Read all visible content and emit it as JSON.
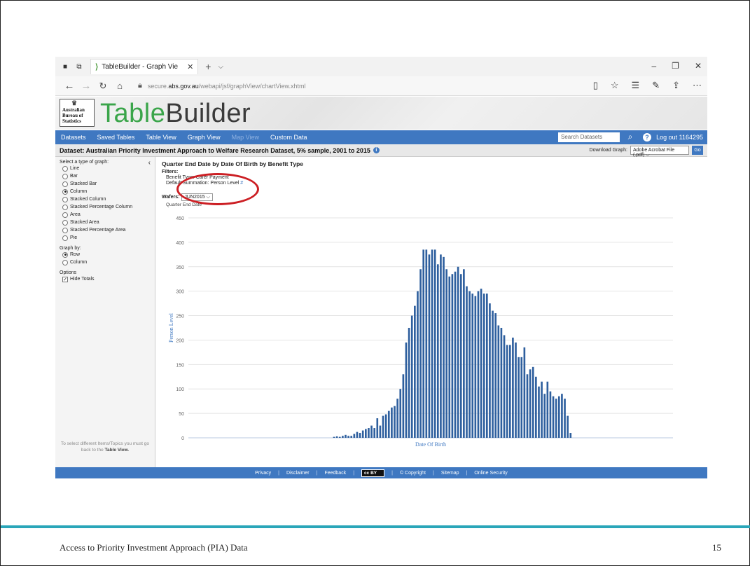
{
  "browser": {
    "tab_title": "TableBuilder - Graph Vie",
    "url_prefix": "secure.",
    "url_domain": "abs.gov.au",
    "url_path": "/webapi/jsf/graphView/chartView.xhtml"
  },
  "site": {
    "logo_text": "Australian Bureau of Statistics",
    "brand_part1": "Table",
    "brand_part2": "Builder"
  },
  "nav": {
    "items": [
      "Datasets",
      "Saved Tables",
      "Table View",
      "Graph View",
      "Map View",
      "Custom Data"
    ],
    "search_placeholder": "Search Datasets",
    "logout": "Log out 1164295"
  },
  "dataset": {
    "title": "Dataset: Australian Priority Investment Approach to Welfare Research Dataset, 5% sample, 2001 to 2015",
    "download_label": "Download Graph:",
    "download_value": "Adobe Acrobat File (.pdf)",
    "go": "Go"
  },
  "left": {
    "type_heading": "Select a type of graph:",
    "types": [
      "Line",
      "Bar",
      "Stacked Bar",
      "Column",
      "Stacked Column",
      "Stacked Percentage Column",
      "Area",
      "Stacked Area",
      "Stacked Percentage Area",
      "Pie"
    ],
    "selected_type": "Column",
    "graphby_heading": "Graph by:",
    "graphby": [
      "Row",
      "Column"
    ],
    "selected_graphby": "Row",
    "options_heading": "Options",
    "hide_totals": "Hide Totals",
    "note_text": "To select different Items/Topics you must go back to the",
    "note_link": "Table View."
  },
  "chart_header": {
    "title": "Quarter End Date by Date Of Birth by Benefit Type",
    "filters_label": "Filters:",
    "filter_benefit": "Benefit Type: Carer Payment",
    "filter_summation": "Default Summation: Person Level",
    "hash": "#",
    "wafers_label": "Wafers:",
    "wafers_value": "JUN2015",
    "wafers_sub": "Quarter End Date"
  },
  "chart_data": {
    "type": "bar",
    "xlabel": "Date Of Birth",
    "ylabel": "Person Level",
    "ylim": [
      0,
      450
    ],
    "yticks": [
      0,
      50,
      100,
      150,
      200,
      250,
      300,
      350,
      400,
      450
    ],
    "grid": true,
    "values": [
      0,
      0,
      0,
      0,
      0,
      0,
      0,
      0,
      0,
      0,
      0,
      0,
      0,
      0,
      0,
      0,
      0,
      0,
      0,
      0,
      0,
      0,
      0,
      0,
      0,
      0,
      0,
      0,
      0,
      0,
      0,
      0,
      0,
      0,
      0,
      0,
      0,
      0,
      0,
      0,
      0,
      0,
      0,
      0,
      0,
      0,
      0,
      0,
      0,
      0,
      2,
      3,
      2,
      4,
      6,
      4,
      4,
      8,
      12,
      10,
      15,
      18,
      20,
      25,
      20,
      40,
      25,
      45,
      48,
      55,
      62,
      65,
      80,
      100,
      130,
      195,
      225,
      250,
      270,
      300,
      345,
      385,
      385,
      375,
      385,
      385,
      355,
      375,
      370,
      345,
      330,
      335,
      340,
      350,
      335,
      345,
      310,
      300,
      295,
      290,
      300,
      305,
      295,
      295,
      275,
      260,
      255,
      230,
      225,
      210,
      190,
      190,
      205,
      195,
      165,
      165,
      185,
      130,
      140,
      145,
      125,
      105,
      115,
      90,
      115,
      95,
      85,
      80,
      85,
      90,
      80,
      45,
      10,
      0,
      0,
      0,
      0,
      0,
      0,
      0,
      0,
      0,
      0,
      0,
      0,
      0,
      0,
      0,
      0,
      0,
      0,
      0,
      0,
      0,
      0,
      0,
      0,
      0,
      0,
      0,
      0,
      0,
      0,
      0,
      0,
      0,
      0,
      0
    ],
    "color": "#2e5f9e"
  },
  "footer": {
    "links": [
      "Privacy",
      "Disclaimer",
      "Feedback",
      "© Copyright",
      "Sitemap",
      "Online Security"
    ],
    "cc": "cc BY"
  },
  "slide": {
    "footer_text": "Access to Priority Investment Approach (PIA) Data",
    "page_number": "15",
    "accent": "#2aa6b9",
    "annotation_color": "#cc1f24"
  }
}
